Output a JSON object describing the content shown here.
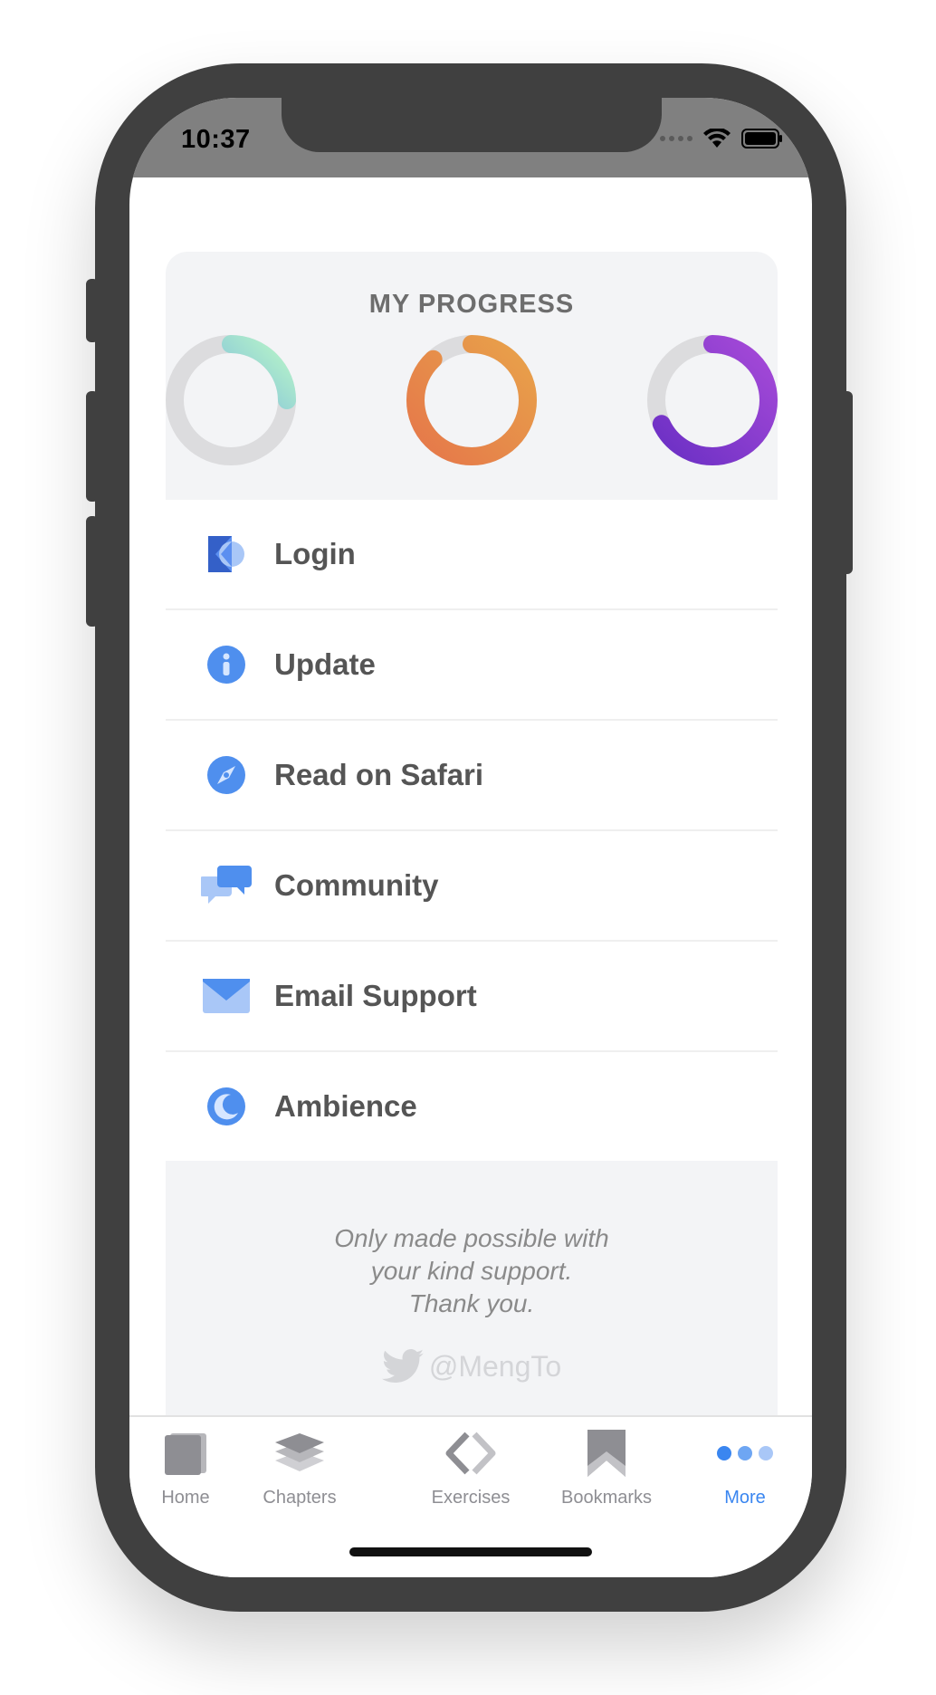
{
  "status_bar": {
    "time": "10:37"
  },
  "progress": {
    "title": "MY PROGRESS",
    "rings": [
      {
        "name": "ring-1",
        "fraction": 0.25,
        "colors": [
          "#4f8fee",
          "#b8f5c8"
        ]
      },
      {
        "name": "ring-2",
        "fraction": 0.88,
        "colors": [
          "#e5774a",
          "#e8a24a"
        ]
      },
      {
        "name": "ring-3",
        "fraction": 0.68,
        "colors": [
          "#6a2fc4",
          "#a64ad8"
        ]
      }
    ],
    "track_color": "#dcdcde"
  },
  "menu": {
    "items": [
      {
        "label": "Login",
        "icon": "login-logo-icon"
      },
      {
        "label": "Update",
        "icon": "info-icon"
      },
      {
        "label": "Read on Safari",
        "icon": "compass-icon"
      },
      {
        "label": "Community",
        "icon": "chat-bubbles-icon"
      },
      {
        "label": "Email Support",
        "icon": "envelope-icon"
      },
      {
        "label": "Ambience",
        "icon": "moon-icon"
      }
    ]
  },
  "footer": {
    "line1": "Only made possible with",
    "line2": "your kind support.",
    "line3": "Thank you.",
    "handle": "@MengTo"
  },
  "tabbar": {
    "tabs": [
      {
        "label": "Home",
        "icon": "book-icon",
        "active": false
      },
      {
        "label": "Chapters",
        "icon": "layers-icon",
        "active": false
      },
      {
        "label": "Exercises",
        "icon": "code-brackets-icon",
        "active": false
      },
      {
        "label": "Bookmarks",
        "icon": "bookmark-icon",
        "active": false
      },
      {
        "label": "More",
        "icon": "more-dots-icon",
        "active": true
      }
    ],
    "active_color": "#3a86f0",
    "inactive_color": "#8e8e93"
  }
}
